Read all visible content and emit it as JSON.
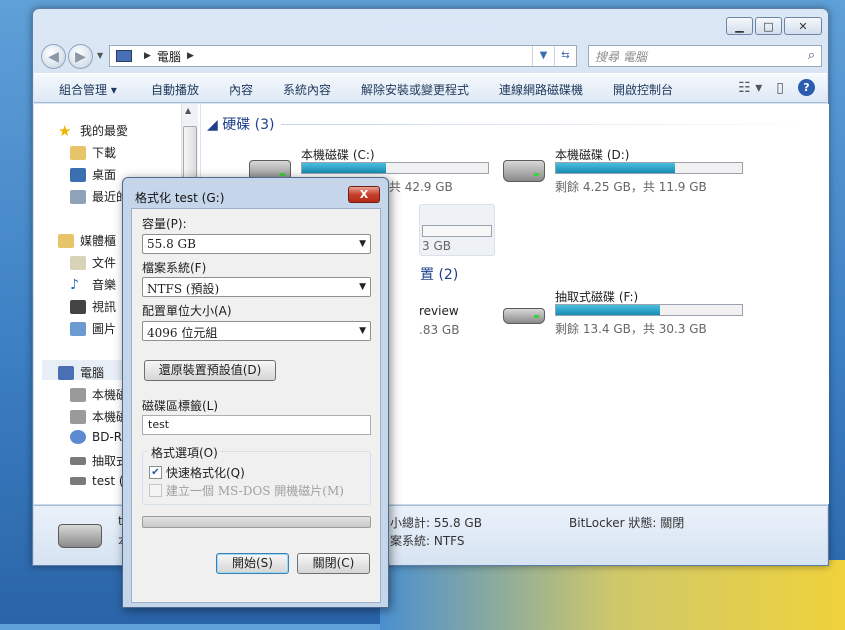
{
  "explorer": {
    "address": {
      "root": "電腦"
    },
    "search_placeholder": "搜尋 電腦",
    "toolbar": {
      "organize": "組合管理",
      "autoplay": "自動播放",
      "contents": "內容",
      "system_properties": "系統內容",
      "uninstall": "解除安裝或變更程式",
      "map_network": "連線網路磁碟機",
      "control_panel": "開啟控制台"
    },
    "sidebar": {
      "favorites": "我的最愛",
      "downloads": "下載",
      "desktop": "桌面",
      "recent": "最近的",
      "libraries": "媒體櫃",
      "documents": "文件",
      "music": "音樂",
      "videos": "視訊",
      "pictures": "圖片",
      "computer": "電腦",
      "local_c": "本機磁",
      "local_d": "本機磁",
      "bd_rom": "BD-RO",
      "removable_f": "抽取式",
      "test_g": "test (C"
    },
    "groups": {
      "hdd_title": "硬碟 (3)",
      "removable_title": "置 (2)"
    },
    "drives": {
      "c": {
        "name": "本機磁碟 (C:)",
        "free": "剩餘 24.9 GB，共 42.9 GB",
        "used_fraction": 0.45
      },
      "d": {
        "name": "本機磁碟 (D:)",
        "free": "剩餘 4.25 GB，共 11.9 GB",
        "used_fraction": 0.64
      },
      "g_partial": {
        "free": "3 GB"
      },
      "preview": {
        "name": "review",
        "free": ".83 GB"
      },
      "f": {
        "name": "抽取式磁碟 (F:)",
        "free": "剩餘 13.4 GB，共 30.3 GB",
        "used_fraction": 0.56
      }
    },
    "details": {
      "name": "t",
      "type": "本",
      "total_label": "小總計:",
      "total_value": "55.8 GB",
      "fs_label": "案系統:",
      "fs_value": "NTFS",
      "bitlocker_label": "BitLocker 狀態:",
      "bitlocker_value": "關閉"
    }
  },
  "dialog": {
    "title": "格式化 test (G:)",
    "close": "X",
    "capacity_label": "容量(P):",
    "capacity_value": "55.8 GB",
    "fs_label": "檔案系統(F)",
    "fs_value": "NTFS (預設)",
    "alloc_label": "配置單位大小(A)",
    "alloc_value": "4096 位元組",
    "restore_button": "還原裝置預設值(D)",
    "volume_label": "磁碟區標籤(L)",
    "volume_value": "test",
    "options_label": "格式選項(O)",
    "quick_format": "快速格式化(Q)",
    "msdos_startup": "建立一個 MS-DOS 開機磁片(M)",
    "start_button": "開始(S)",
    "close_button": "關閉(C)"
  }
}
